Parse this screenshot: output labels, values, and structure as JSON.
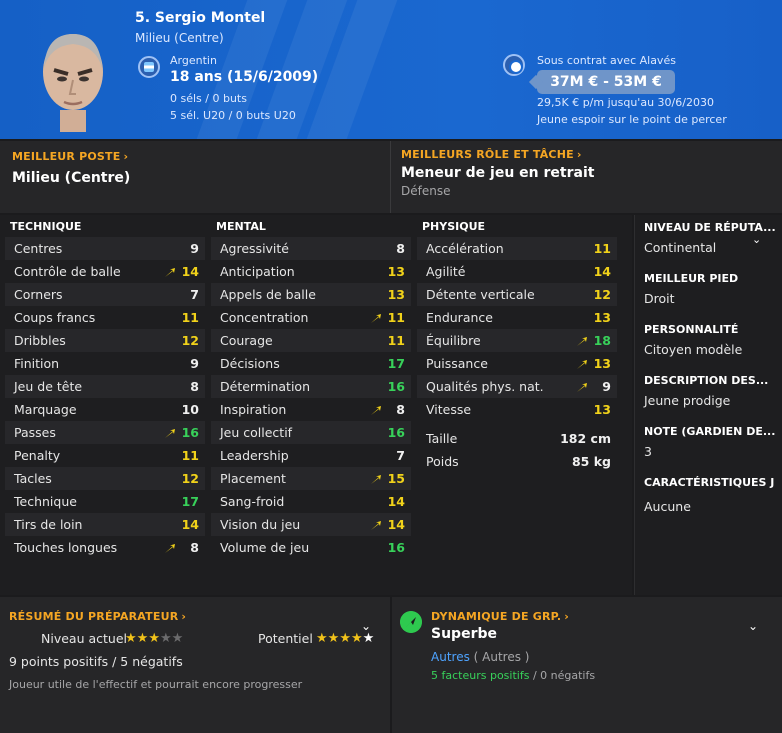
{
  "header": {
    "name": "5. Sergio Montel",
    "position": "Milieu (Centre)",
    "nationality": "Argentin",
    "age": "18 ans (15/6/2009)",
    "caps": "0 séls / 0 buts",
    "u20_caps": "5 sél. U20 / 0 buts U20",
    "contract": "Sous contrat avec Alavés",
    "value": "37M € - 53M €",
    "wage": "29,5K € p/m jusqu'au 30/6/2030",
    "expectation": "Jeune espoir sur le point de percer"
  },
  "best_position": {
    "title": "MEILLEUR POSTE",
    "value": "Milieu (Centre)"
  },
  "best_role": {
    "title": "MEILLEURS RÔLE ET TÂCHE",
    "value": "Meneur de jeu en retrait",
    "duty": "Défense"
  },
  "technique": {
    "title": "TECHNIQUE",
    "rows": [
      {
        "label": "Centres",
        "value": "9",
        "color": "white",
        "arrow": false
      },
      {
        "label": "Contrôle de balle",
        "value": "14",
        "color": "yellow",
        "arrow": true
      },
      {
        "label": "Corners",
        "value": "7",
        "color": "white",
        "arrow": false
      },
      {
        "label": "Coups francs",
        "value": "11",
        "color": "yellow",
        "arrow": false
      },
      {
        "label": "Dribbles",
        "value": "12",
        "color": "yellow",
        "arrow": false
      },
      {
        "label": "Finition",
        "value": "9",
        "color": "white",
        "arrow": false
      },
      {
        "label": "Jeu de tête",
        "value": "8",
        "color": "white",
        "arrow": false
      },
      {
        "label": "Marquage",
        "value": "10",
        "color": "white",
        "arrow": false
      },
      {
        "label": "Passes",
        "value": "16",
        "color": "green",
        "arrow": true
      },
      {
        "label": "Penalty",
        "value": "11",
        "color": "yellow",
        "arrow": false
      },
      {
        "label": "Tacles",
        "value": "12",
        "color": "yellow",
        "arrow": false
      },
      {
        "label": "Technique",
        "value": "17",
        "color": "green",
        "arrow": false
      },
      {
        "label": "Tirs de loin",
        "value": "14",
        "color": "yellow",
        "arrow": false
      },
      {
        "label": "Touches longues",
        "value": "8",
        "color": "white",
        "arrow": true
      }
    ]
  },
  "mental": {
    "title": "MENTAL",
    "rows": [
      {
        "label": "Agressivité",
        "value": "8",
        "color": "white",
        "arrow": false
      },
      {
        "label": "Anticipation",
        "value": "13",
        "color": "yellow",
        "arrow": false
      },
      {
        "label": "Appels de balle",
        "value": "13",
        "color": "yellow",
        "arrow": false
      },
      {
        "label": "Concentration",
        "value": "11",
        "color": "yellow",
        "arrow": true
      },
      {
        "label": "Courage",
        "value": "11",
        "color": "yellow",
        "arrow": false
      },
      {
        "label": "Décisions",
        "value": "17",
        "color": "green",
        "arrow": false
      },
      {
        "label": "Détermination",
        "value": "16",
        "color": "green",
        "arrow": false
      },
      {
        "label": "Inspiration",
        "value": "8",
        "color": "white",
        "arrow": true
      },
      {
        "label": "Jeu collectif",
        "value": "16",
        "color": "green",
        "arrow": false
      },
      {
        "label": "Leadership",
        "value": "7",
        "color": "white",
        "arrow": false
      },
      {
        "label": "Placement",
        "value": "15",
        "color": "yellow",
        "arrow": true
      },
      {
        "label": "Sang-froid",
        "value": "14",
        "color": "yellow",
        "arrow": false
      },
      {
        "label": "Vision du jeu",
        "value": "14",
        "color": "yellow",
        "arrow": true
      },
      {
        "label": "Volume de jeu",
        "value": "16",
        "color": "green",
        "arrow": false
      }
    ]
  },
  "physique": {
    "title": "PHYSIQUE",
    "rows": [
      {
        "label": "Accélération",
        "value": "11",
        "color": "yellow",
        "arrow": false
      },
      {
        "label": "Agilité",
        "value": "14",
        "color": "yellow",
        "arrow": false
      },
      {
        "label": "Détente verticale",
        "value": "12",
        "color": "yellow",
        "arrow": false
      },
      {
        "label": "Endurance",
        "value": "13",
        "color": "yellow",
        "arrow": false
      },
      {
        "label": "Équilibre",
        "value": "18",
        "color": "green",
        "arrow": true
      },
      {
        "label": "Puissance",
        "value": "13",
        "color": "yellow",
        "arrow": true
      },
      {
        "label": "Qualités phys. nat.",
        "value": "9",
        "color": "white",
        "arrow": true
      },
      {
        "label": "Vitesse",
        "value": "13",
        "color": "yellow",
        "arrow": false
      }
    ],
    "height_label": "Taille",
    "height": "182 cm",
    "weight_label": "Poids",
    "weight": "85 kg"
  },
  "info": {
    "reputation_label": "NIVEAU DE RÉPUTA...",
    "reputation": "Continental",
    "foot_label": "MEILLEUR PIED",
    "foot": "Droit",
    "personality_label": "PERSONNALITÉ",
    "personality": "Citoyen modèle",
    "description_label": "DESCRIPTION DES...",
    "description": "Jeune prodige",
    "gk_label": "NOTE (GARDIEN DE...",
    "gk": "3",
    "features_label": "CARACTÉRISTIQUES J",
    "features": "Aucune"
  },
  "coach": {
    "title": "RÉSUMÉ DU PRÉPARATEUR",
    "current_label": "Niveau actuel",
    "current_stars": 2.5,
    "potential_label": "Potentiel",
    "potential_stars": 4.5,
    "points": "9 points positifs / 5 négatifs",
    "comment": "Joueur utile de l'effectif et pourrait encore progresser"
  },
  "dynamics": {
    "title": "DYNAMIQUE DE GRP.",
    "value": "Superbe",
    "other_link": "Autres",
    "other_paren": "( Autres )",
    "positive": "5 facteurs positifs",
    "negative": "0 négatifs"
  },
  "colors": {
    "accent": "#f5a623",
    "header_blue": "#1a68d0",
    "green": "#38d15a",
    "yellow": "#f1d21a"
  }
}
